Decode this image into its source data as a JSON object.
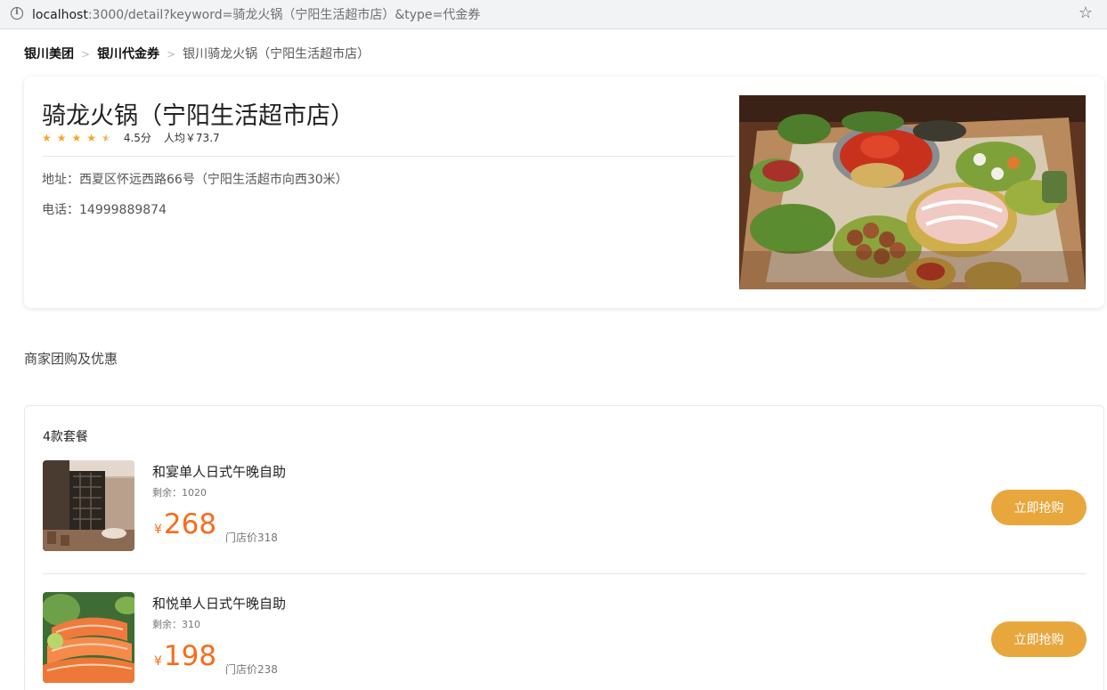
{
  "browser": {
    "url_host": "localhost",
    "url_path": ":3000/detail?keyword=骑龙火锅（宁阳生活超市店）&type=代金券",
    "info_icon_glyph": "i",
    "star_icon_glyph": "☆"
  },
  "breadcrumb": {
    "items": [
      "银川美团",
      "银川代金券",
      "银川骑龙火锅（宁阳生活超市店）"
    ],
    "separator": ">"
  },
  "store": {
    "name": "骑龙火锅（宁阳生活超市店）",
    "rating_stars": 4.5,
    "score_text": "4.5分",
    "avg_price_text": "人均￥73.7",
    "address": "地址：西夏区怀远西路66号（宁阳生活超市向西30米）",
    "phone": "电话：14999889874",
    "photo_icon": "hotpot-photo"
  },
  "section_title": "商家团购及优惠",
  "deals": {
    "count_text": "4款套餐",
    "items": [
      {
        "name": "和宴单人日式午晚自助",
        "stock": "剩余：1020",
        "currency": "¥",
        "price": "268",
        "original": "门店价318",
        "button": "立即抢购",
        "thumb_icon": "restaurant-interior-photo"
      },
      {
        "name": "和悦单人日式午晚自助",
        "stock": "剩余：310",
        "currency": "¥",
        "price": "198",
        "original": "门店价238",
        "button": "立即抢购",
        "thumb_icon": "salmon-sashimi-photo"
      }
    ]
  },
  "colors": {
    "star": "#f6a623",
    "price": "#f76b1c",
    "button": "#e8a73c"
  }
}
